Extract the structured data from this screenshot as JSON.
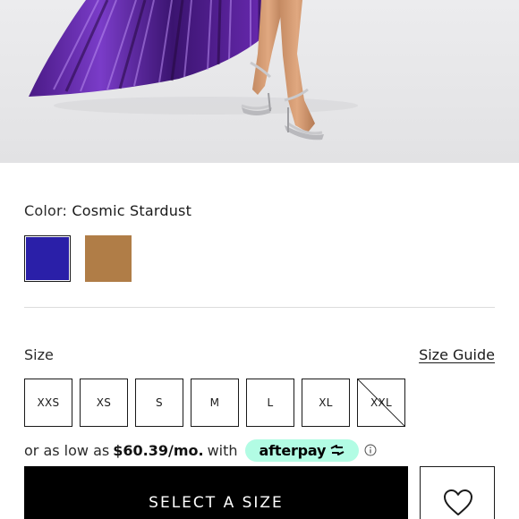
{
  "product_image": {
    "alt_subject": "model-in-metallic-purple-pleated-skirt-and-silver-sandals"
  },
  "color": {
    "label": "Color:",
    "selected_name": "Cosmic Stardust",
    "swatches": [
      {
        "color": "#2a1fa8",
        "selected": true
      },
      {
        "color": "#b07d47",
        "selected": false
      }
    ]
  },
  "size": {
    "label": "Size",
    "guide_label": "Size Guide",
    "options": [
      {
        "label": "XXS",
        "available": true
      },
      {
        "label": "XS",
        "available": true
      },
      {
        "label": "S",
        "available": true
      },
      {
        "label": "M",
        "available": true
      },
      {
        "label": "L",
        "available": true
      },
      {
        "label": "XL",
        "available": true
      },
      {
        "label": "XXL",
        "available": false
      }
    ]
  },
  "afterpay": {
    "prefix": "or as low as",
    "price": "$60.39/mo.",
    "suffix": "with",
    "brand": "afterpay",
    "brand_color": "#b2fce4"
  },
  "actions": {
    "select_size_label": "SELECT A SIZE",
    "wishlist_icon": "heart-icon"
  }
}
